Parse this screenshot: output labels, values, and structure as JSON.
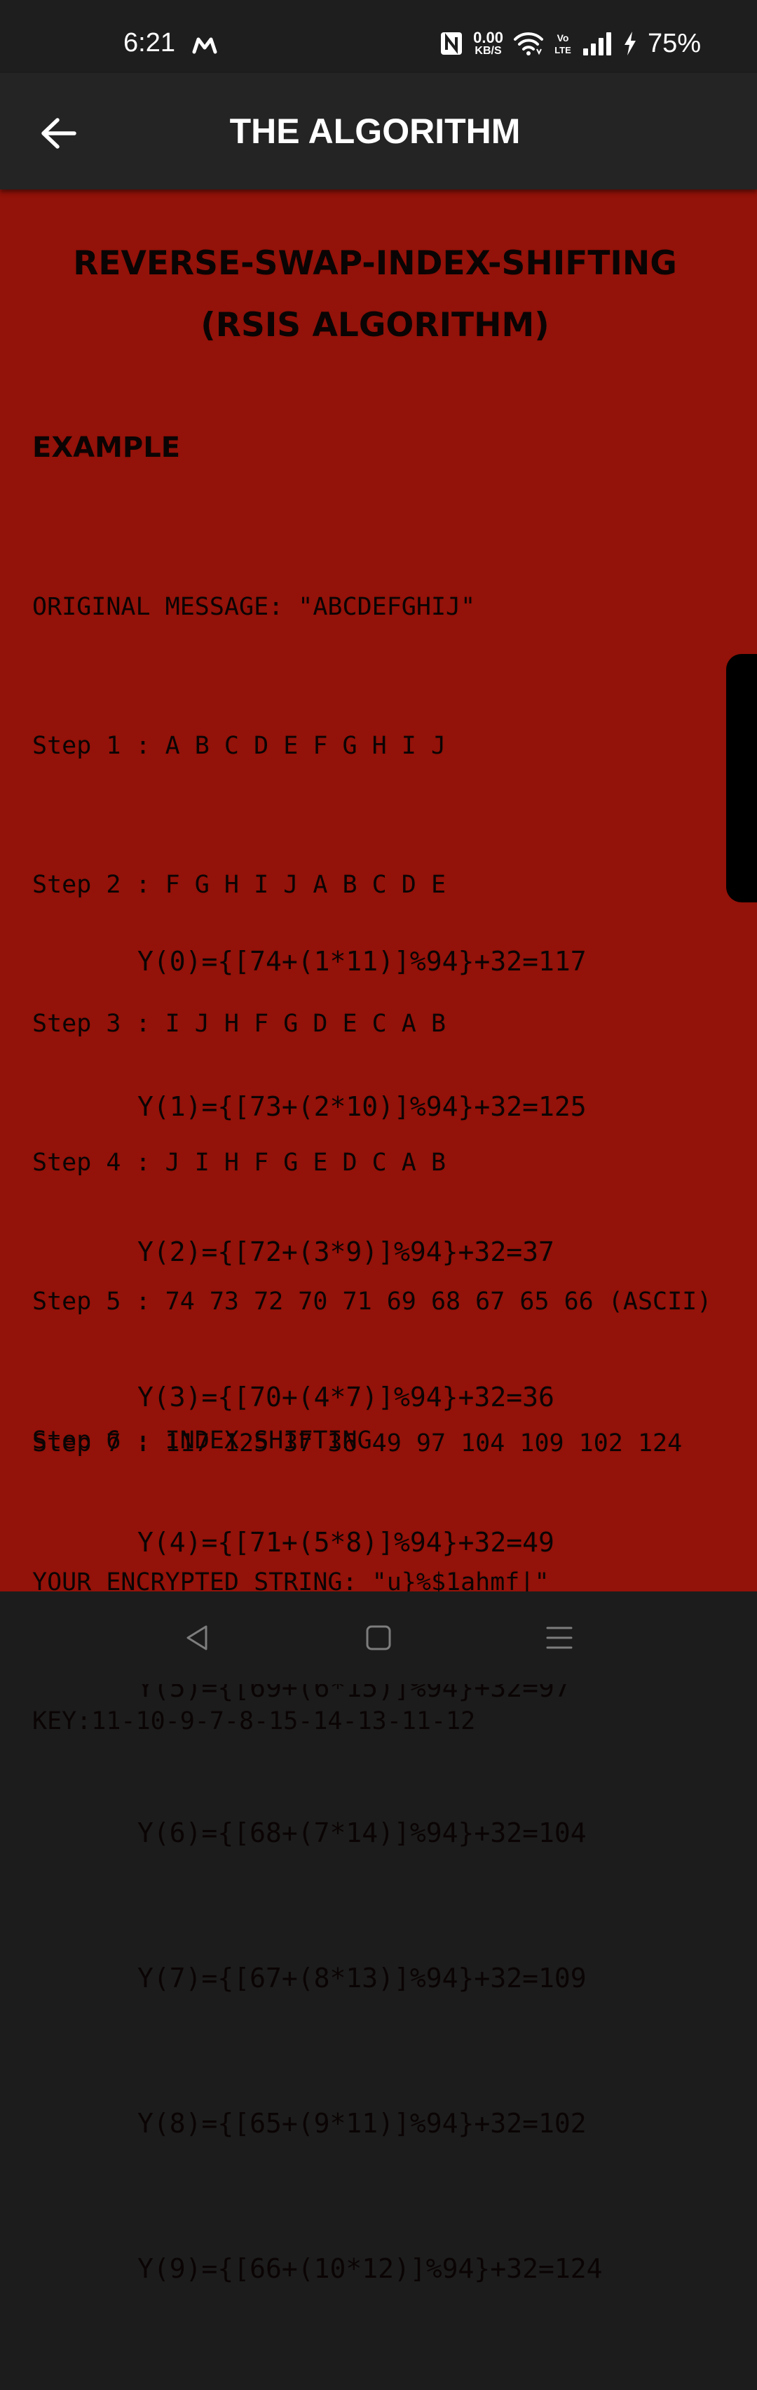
{
  "status_bar": {
    "time": "6:21",
    "data_speed_value": "0.00",
    "data_speed_unit": "KB/S",
    "volte_label": "Vo LTE",
    "battery": "75%",
    "icons": [
      "m-logo-icon",
      "nfc-icon",
      "wifi-icon",
      "volte-icon",
      "signal-icon",
      "charging-bolt-icon"
    ]
  },
  "app_bar": {
    "back_icon": "arrow-left-icon",
    "title": "THE ALGORITHM"
  },
  "content": {
    "heading_line1": "REVERSE-SWAP-INDEX-SHIFTING",
    "heading_line2": "(RSIS ALGORITHM)",
    "example_label": "EXAMPLE",
    "steps": [
      "ORIGINAL MESSAGE: \"ABCDEFGHIJ\"",
      "Step 1 : A B C D E F G H I J",
      "Step 2 : F G H I J A B C D E",
      "Step 3 : I J H F G D E C A B",
      "Step 4 : J I H F G E D C A B",
      "Step 5 : 74 73 72 70 71 69 68 67 65 66 (ASCII)",
      "Step 6 : INDEX SHIFTING"
    ],
    "formulas": [
      "Y(0)={[74+(1*11)]%94}+32=117",
      "Y(1)={[73+(2*10)]%94}+32=125",
      "Y(2)={[72+(3*9)]%94}+32=37",
      "Y(3)={[70+(4*7)]%94}+32=36",
      "Y(4)={[71+(5*8)]%94}+32=49",
      "Y(5)={[69+(6*15)]%94}+32=97",
      "Y(6)={[68+(7*14)]%94}+32=104",
      "Y(7)={[67+(8*13)]%94}+32=109",
      "Y(8)={[65+(9*11)]%94}+32=102",
      "Y(9)={[66+(10*12)]%94}+32=124"
    ],
    "results": [
      "Step 7 : 117 125 37 36 49 97 104 109 102 124",
      "YOUR ENCRYPTED STRING: \"u}%$1ahmf|\"",
      "KEY:11-10-9-7-8-15-14-13-11-12"
    ]
  },
  "nav_bar": {
    "icons": [
      "nav-back-icon",
      "nav-home-icon",
      "nav-recents-icon"
    ]
  },
  "colors": {
    "status_bar_bg": "#1e1e1f",
    "app_bar_bg": "#242424",
    "content_bg": "#931209",
    "text": "#0b0404",
    "nav_bar_bg": "#1c1c1c"
  }
}
